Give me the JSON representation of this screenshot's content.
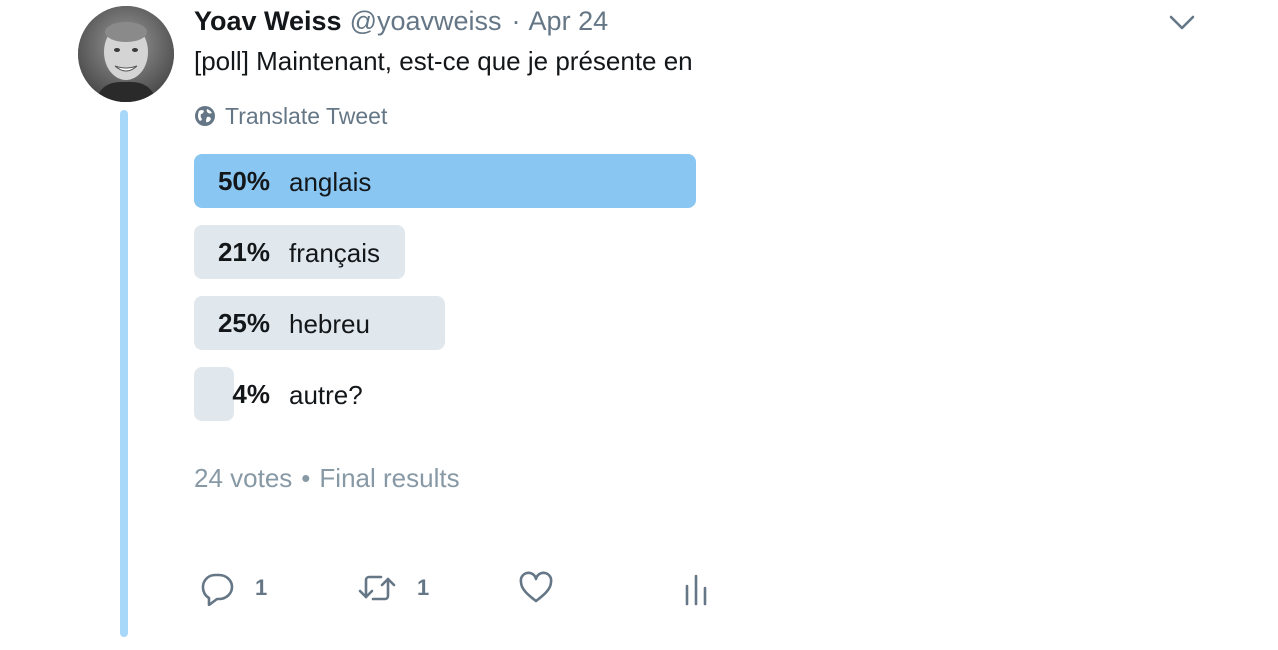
{
  "tweet": {
    "author_name": "Yoav Weiss",
    "handle": "@yoavweiss",
    "separator": "·",
    "date": "Apr 24",
    "text": "[poll] Maintenant, est-ce que je présente en",
    "translate_label": "Translate Tweet"
  },
  "poll": {
    "options": [
      {
        "percent_label": "50%",
        "label": "anglais",
        "value": 50,
        "winner": true
      },
      {
        "percent_label": "21%",
        "label": "français",
        "value": 21,
        "winner": false
      },
      {
        "percent_label": "25%",
        "label": "hebreu",
        "value": 25,
        "winner": false
      },
      {
        "percent_label": "4%",
        "label": "autre?",
        "value": 4,
        "winner": false
      }
    ],
    "votes": "24 votes",
    "dot": "•",
    "status": "Final results"
  },
  "actions": {
    "reply_count": "1",
    "retweet_count": "1"
  },
  "colors": {
    "winner_bar": "#8ac6f2",
    "other_bar": "#e1e8ed",
    "thread_line": "#a7d7f9",
    "secondary_text": "#657786"
  },
  "icons": [
    "avatar-photo",
    "chevron-down-icon",
    "globe-icon",
    "reply-icon",
    "retweet-icon",
    "heart-icon",
    "analytics-icon"
  ]
}
